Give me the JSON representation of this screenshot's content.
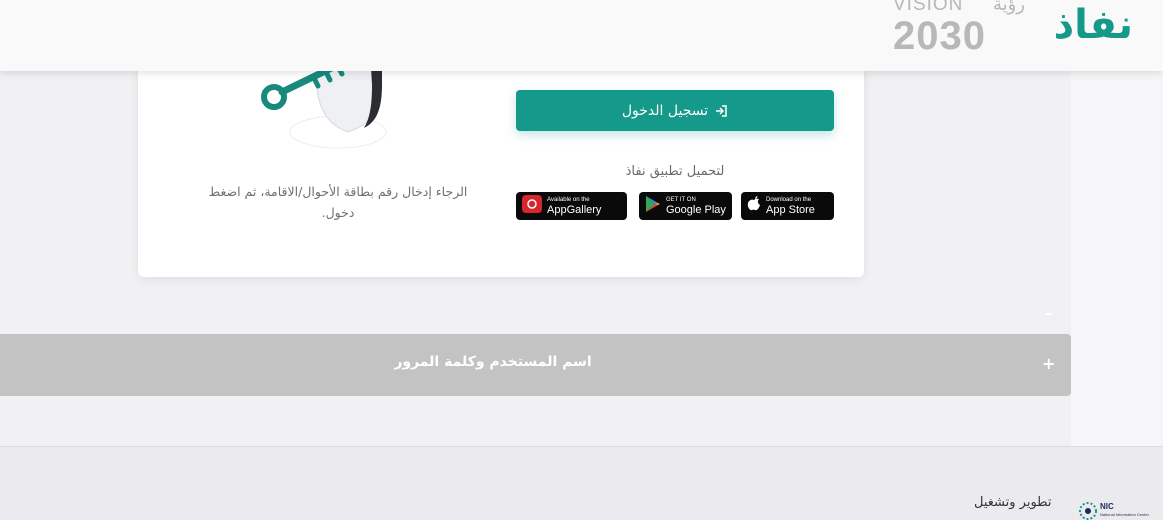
{
  "header": {
    "brand": "نفاذ",
    "vision": {
      "latin": "VISION",
      "arabic": "رؤية",
      "year": "2030"
    }
  },
  "card": {
    "login_button": "تسجيل الدخول",
    "download_label": "لتحميل تطبيق نفاذ",
    "stores": {
      "apple": {
        "small": "Download on the",
        "big": "App Store"
      },
      "google": {
        "small": "GET IT ON",
        "big": "Google Play"
      },
      "huawei": {
        "small": "Available on the",
        "big": "AppGallery"
      }
    },
    "instruction": "الرجاء إدخال رقم بطاقة الأحوال/الاقامة، ثم اضغط دخول."
  },
  "accordion": {
    "title": "اسم المستخدم وكلمة المرور",
    "toggle": "+"
  },
  "footer": {
    "label": "تطوير وتشغيل",
    "nic": "NIC",
    "nic_sub": "National Information Center"
  },
  "colors": {
    "primary": "#14998a",
    "accordion": "#c3c3c3"
  },
  "icons": [
    "login-arrow-icon",
    "apple-icon",
    "google-play-icon",
    "huawei-icon",
    "key-shield-illustration",
    "nic-logo"
  ]
}
